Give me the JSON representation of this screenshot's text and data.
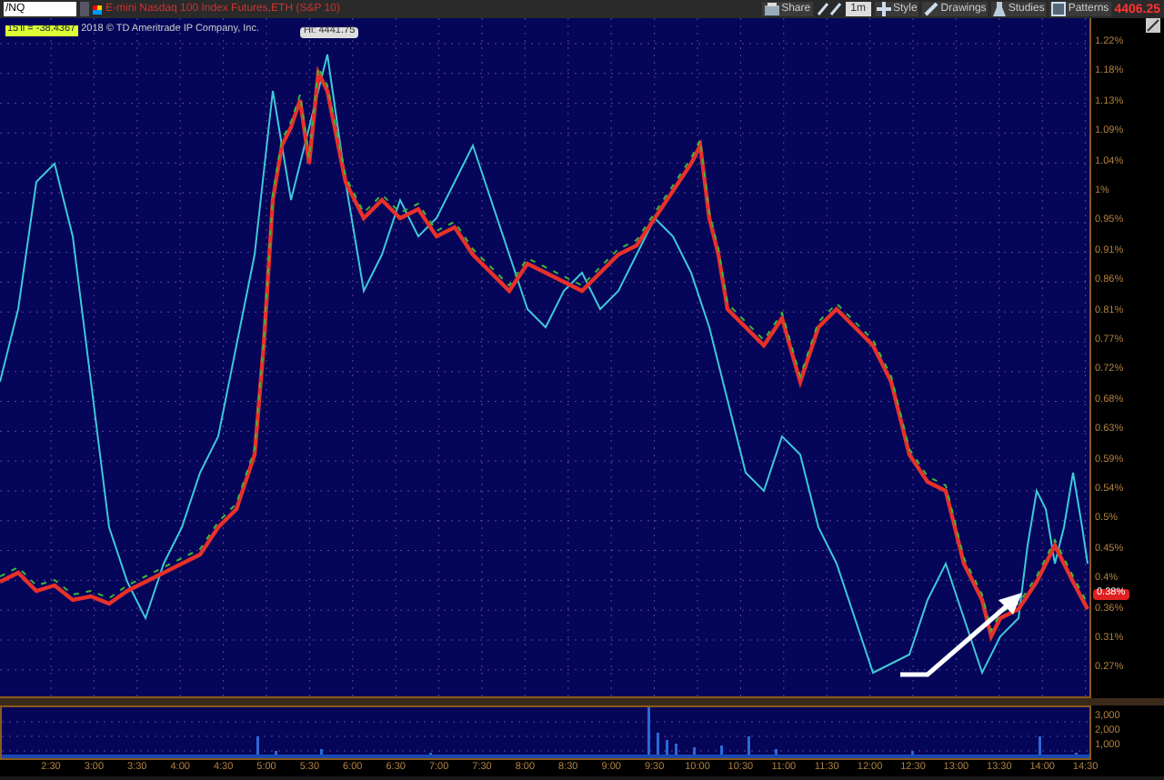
{
  "toolbar": {
    "symbol": "/NQ",
    "title": "E-mini Nasdaq 100 Index Futures,ETH (S&P 10)",
    "interval": "1m",
    "price": "4406.25",
    "buttons": [
      {
        "label": "Share",
        "kind": "share"
      },
      {
        "label": "Style",
        "kind": "style"
      },
      {
        "label": "Drawings",
        "kind": "drawings"
      },
      {
        "label": "Studies",
        "kind": "studies"
      },
      {
        "label": "Patterns",
        "kind": "patterns"
      }
    ]
  },
  "chart": {
    "study_label": "15'll = -38.4367",
    "copyright": "2018 © TD Ameritrade IP Company, Inc.",
    "high_label": "Hi: 4441.75",
    "last_value": "0.38%",
    "y_axis": [
      "1.22%",
      "1.18%",
      "1.13%",
      "1.09%",
      "1.04%",
      "1%",
      "0.95%",
      "0.91%",
      "0.86%",
      "0.81%",
      "0.77%",
      "0.72%",
      "0.68%",
      "0.63%",
      "0.59%",
      "0.54%",
      "0.5%",
      "0.45%",
      "0.4%",
      "0.36%",
      "0.31%",
      "0.27%"
    ],
    "volume_axis": [
      "3,000",
      "2,000",
      "1,000"
    ],
    "x_axis": [
      "2:30",
      "3:00",
      "3:30",
      "4:00",
      "4:30",
      "5:00",
      "5:30",
      "6:00",
      "6:30",
      "7:00",
      "7:30",
      "8:00",
      "8:30",
      "9:00",
      "9:30",
      "10:00",
      "10:30",
      "11:00",
      "11:30",
      "12:00",
      "12:30",
      "13:00",
      "13:30",
      "14:00",
      "14:30"
    ]
  }
}
